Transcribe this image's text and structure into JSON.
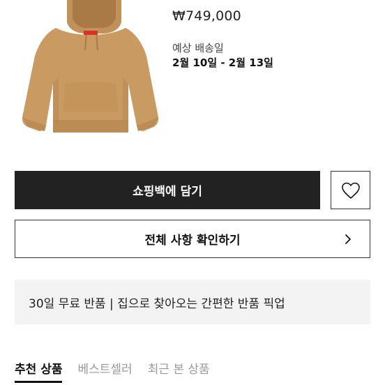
{
  "product": {
    "price": "₩749,000",
    "shipping_label": "예상 배송일",
    "shipping_dates": "2월 10일 - 2월 13일"
  },
  "actions": {
    "cart_label": "쇼핑백에 담기",
    "wishlist_icon": "heart-icon",
    "info_label": "전체 사항 확인하기",
    "info_icon": "chevron-right-icon"
  },
  "notice": {
    "return_text": "30일 무료 반품 | 집으로 찾아오는 간편한 반품 픽업"
  },
  "tabs": [
    {
      "label": "추천 상품",
      "active": true
    },
    {
      "label": "베스트셀러",
      "active": false
    },
    {
      "label": "최근 본 상품",
      "active": false
    }
  ],
  "colors": {
    "hoodie": "#c99a62",
    "button_dark": "#222222",
    "notice_bg": "#f3f3f3"
  }
}
